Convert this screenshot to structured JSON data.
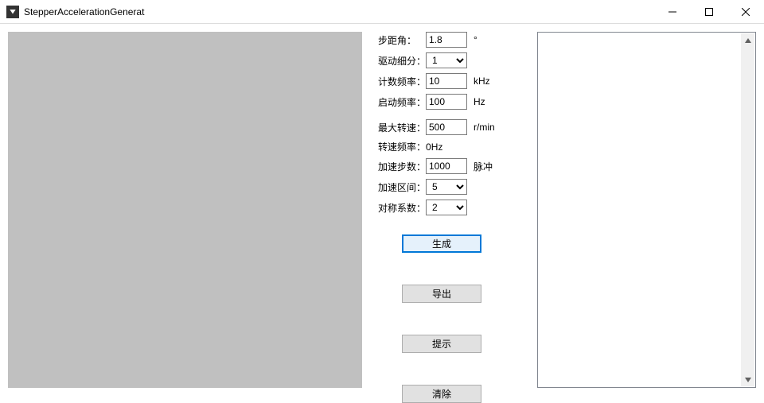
{
  "window": {
    "title": "StepperAccelerationGenerat"
  },
  "form": {
    "step_angle": {
      "label": "步距角：",
      "value": "1.8",
      "unit": "°"
    },
    "microstep": {
      "label": "驱动细分：",
      "value": "1"
    },
    "count_freq": {
      "label": "计数频率：",
      "value": "10",
      "unit": "kHz"
    },
    "start_freq": {
      "label": "启动频率：",
      "value": "100",
      "unit": "Hz"
    },
    "max_rpm": {
      "label": "最大转速：",
      "value": "500",
      "unit": "r/min"
    },
    "rpm_freq": {
      "label": "转速频率：",
      "text": "0Hz"
    },
    "accel_steps": {
      "label": "加速步数：",
      "value": "1000",
      "unit": "脉冲"
    },
    "accel_zone": {
      "label": "加速区间：",
      "value": "5"
    },
    "symmetry": {
      "label": "对称系数：",
      "value": "2"
    }
  },
  "buttons": {
    "generate": "生成",
    "export": "导出",
    "hint": "提示",
    "clear": "清除"
  }
}
